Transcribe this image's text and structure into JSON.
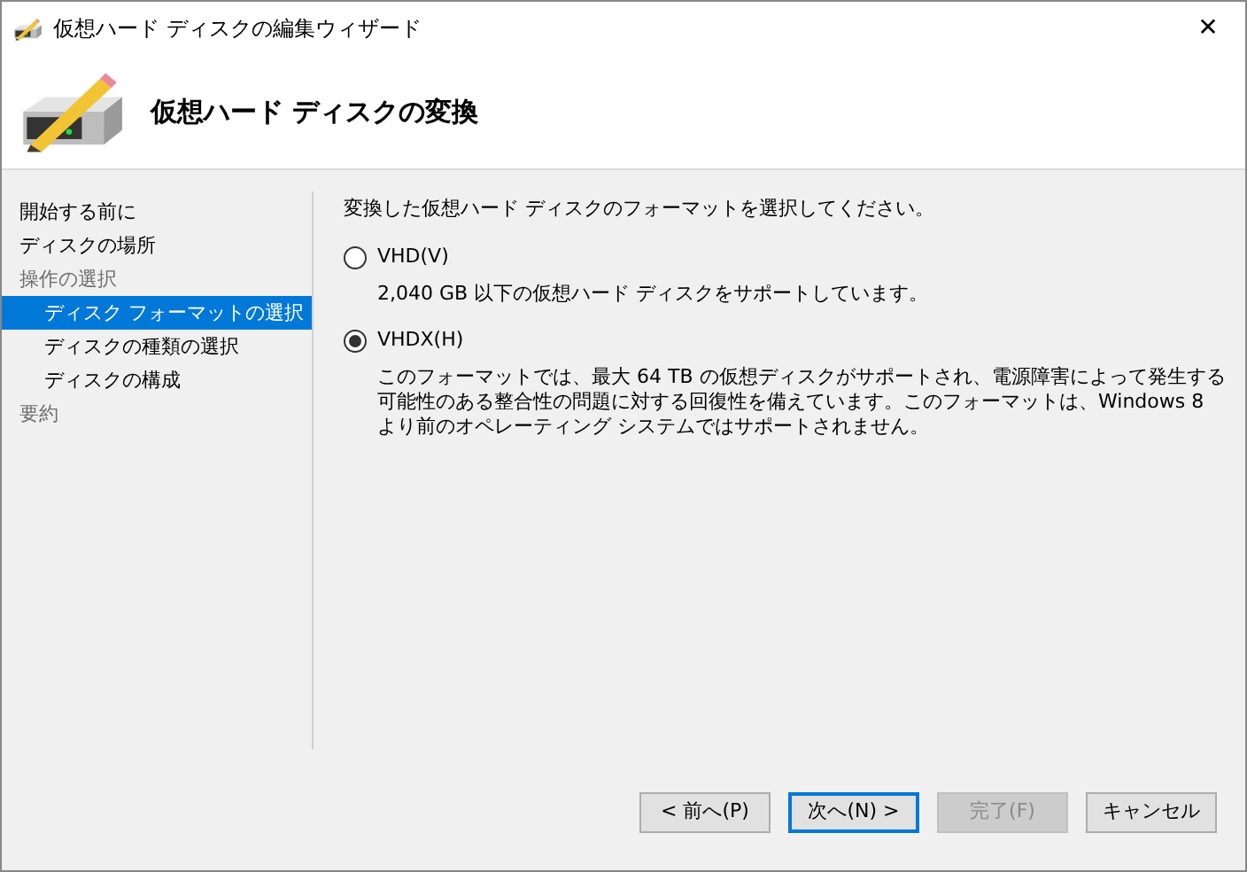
{
  "window": {
    "title": "仮想ハード ディスクの編集ウィザード",
    "close": "✕"
  },
  "header": {
    "title": "仮想ハード ディスクの変換"
  },
  "sidebar": {
    "items": [
      {
        "label": "開始する前に",
        "selected": false,
        "disabled": false
      },
      {
        "label": "ディスクの場所",
        "selected": false,
        "disabled": false
      },
      {
        "label": "操作の選択",
        "selected": false,
        "disabled": true,
        "children": [
          {
            "label": "ディスク フォーマットの選択",
            "selected": true,
            "disabled": false
          },
          {
            "label": "ディスクの種類の選択",
            "selected": false,
            "disabled": false
          },
          {
            "label": "ディスクの構成",
            "selected": false,
            "disabled": false
          }
        ]
      },
      {
        "label": "要約",
        "selected": false,
        "disabled": true
      }
    ]
  },
  "content": {
    "prompt": "変換した仮想ハード ディスクのフォーマットを選択してください。",
    "options": [
      {
        "label": "VHD(V)",
        "selected": false,
        "description": "2,040 GB 以下の仮想ハード ディスクをサポートしています。"
      },
      {
        "label": "VHDX(H)",
        "selected": true,
        "description": "このフォーマットでは、最大 64 TB の仮想ディスクがサポートされ、電源障害によって発生する可能性のある整合性の問題に対する回復性を備えています。このフォーマットは、Windows 8 より前のオペレーティング システムではサポートされません。"
      }
    ]
  },
  "buttons": [
    {
      "label": "< 前へ(P)",
      "disabled": false,
      "focused": false
    },
    {
      "label": "次へ(N) >",
      "disabled": false,
      "focused": true
    },
    {
      "label": "完了(F)",
      "disabled": true,
      "focused": false
    },
    {
      "label": "キャンセル",
      "disabled": false,
      "focused": false
    }
  ]
}
